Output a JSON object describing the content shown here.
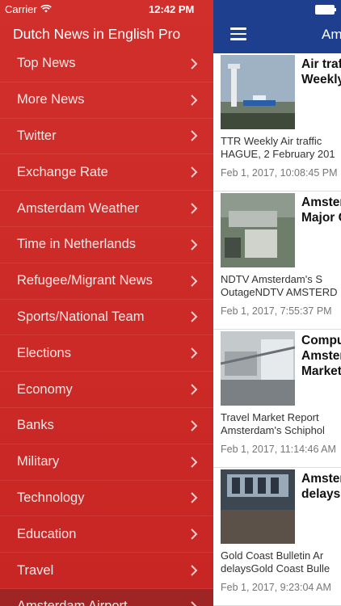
{
  "status": {
    "carrier": "Carrier",
    "time": "12:42 PM"
  },
  "drawer": {
    "title": "Dutch News in English Pro",
    "items": [
      {
        "label": "Top News"
      },
      {
        "label": "More News"
      },
      {
        "label": "Twitter"
      },
      {
        "label": "Exchange Rate"
      },
      {
        "label": "Amsterdam Weather"
      },
      {
        "label": "Time in Netherlands"
      },
      {
        "label": "Refugee/Migrant News"
      },
      {
        "label": "Sports/National Team"
      },
      {
        "label": "Elections"
      },
      {
        "label": "Economy"
      },
      {
        "label": "Banks"
      },
      {
        "label": "Military"
      },
      {
        "label": "Technology"
      },
      {
        "label": "Education"
      },
      {
        "label": "Travel"
      },
      {
        "label": "Amsterdam Airport"
      }
    ]
  },
  "navbar": {
    "title": "Am"
  },
  "articles": [
    {
      "title_line1": "Air traf",
      "title_line2": "Weekly",
      "desc_line1": "TTR Weekly    Air traffic",
      "desc_line2": "HAGUE, 2 February 201",
      "date": "Feb 1, 2017, 10:08:45 PM"
    },
    {
      "title_line1": "Amster",
      "title_line2": "Major C",
      "desc_line1": "NDTV    Amsterdam's S",
      "desc_line2": "OutageNDTV  AMSTERD",
      "date": "Feb 1, 2017, 7:55:37 PM"
    },
    {
      "title_line1": "Compu",
      "title_line2": "Amster",
      "title_line3": "Market",
      "desc_line1": "Travel Market Report",
      "desc_line2": "Amsterdam's Schiphol",
      "date": "Feb 1, 2017, 11:14:46 AM"
    },
    {
      "title_line1": "Amster",
      "title_line2": "delays",
      "desc_line1": "Gold Coast Bulletin    Ar",
      "desc_line2": "delaysGold Coast Bulle",
      "date": "Feb 1, 2017, 9:23:04 AM"
    }
  ],
  "colors": {
    "drawer_bg": "#cc2b28",
    "selected_bg": "#9e2524",
    "navbar_bg": "#1e3f8e"
  }
}
